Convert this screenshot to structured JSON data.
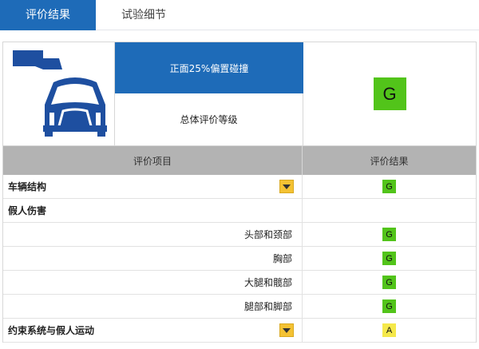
{
  "tabs": [
    {
      "label": "评价结果",
      "active": true
    },
    {
      "label": "试验细节",
      "active": false
    }
  ],
  "summary": {
    "test_title": "正面25%偏置碰撞",
    "overall_label": "总体评价等级",
    "overall_grade": "G",
    "overall_grade_color": "#52c41a"
  },
  "table": {
    "headers": {
      "item": "评价项目",
      "result": "评价结果"
    },
    "rows": [
      {
        "label": "车辆结构",
        "grade": "G",
        "grade_color": "#52c41a",
        "expandable": true,
        "indent": false
      },
      {
        "label": "假人伤害",
        "grade": "",
        "grade_color": "",
        "expandable": false,
        "indent": false
      },
      {
        "label": "头部和颈部",
        "grade": "G",
        "grade_color": "#52c41a",
        "expandable": false,
        "indent": true
      },
      {
        "label": "胸部",
        "grade": "G",
        "grade_color": "#52c41a",
        "expandable": false,
        "indent": true
      },
      {
        "label": "大腿和髋部",
        "grade": "G",
        "grade_color": "#52c41a",
        "expandable": false,
        "indent": true
      },
      {
        "label": "腿部和脚部",
        "grade": "G",
        "grade_color": "#52c41a",
        "expandable": false,
        "indent": true
      },
      {
        "label": "约束系统与假人运动",
        "grade": "A",
        "grade_color": "#f5e84a",
        "expandable": true,
        "indent": false
      }
    ]
  },
  "colors": {
    "accent": "#1e6bb8",
    "header_gray": "#b3b3b3",
    "dropdown_yellow": "#f4c233"
  },
  "icons": {
    "test_diagram": "small-overlap-frontal-crash-icon",
    "expand": "chevron-down-icon"
  }
}
